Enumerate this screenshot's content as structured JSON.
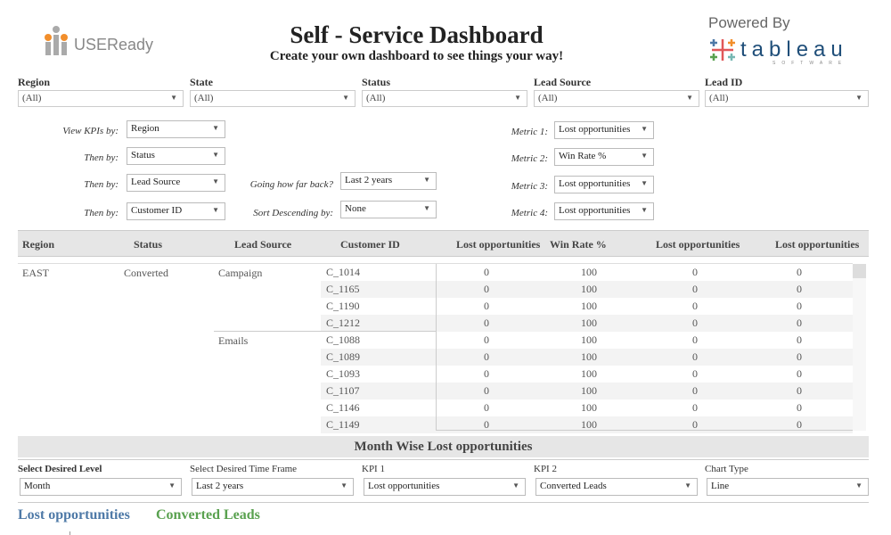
{
  "header": {
    "title": "Self - Service Dashboard",
    "subtitle": "Create your own dashboard to see things your way!",
    "logo_left": "USEReady",
    "powered_by": "Powered By",
    "logo_right": "tableau",
    "logo_right_sub": "SOFTWARE"
  },
  "filters": [
    {
      "label": "Region",
      "value": "(All)"
    },
    {
      "label": "State",
      "value": "(All)"
    },
    {
      "label": "Status",
      "value": "(All)"
    },
    {
      "label": "Lead Source",
      "value": "(All)"
    },
    {
      "label": "Lead ID",
      "value": "(All)"
    }
  ],
  "view_by": [
    {
      "label": "View KPIs by:",
      "value": "Region"
    },
    {
      "label": "Then by:",
      "value": "Status"
    },
    {
      "label": "Then by:",
      "value": "Lead Source"
    },
    {
      "label": "Then by:",
      "value": "Customer ID"
    }
  ],
  "options": [
    {
      "label": "Going how far back?",
      "value": "Last 2 years"
    },
    {
      "label": "Sort Descending by:",
      "value": "None"
    }
  ],
  "metrics": [
    {
      "label": "Metric 1:",
      "value": "Lost opportunities"
    },
    {
      "label": "Metric 2:",
      "value": "Win Rate %"
    },
    {
      "label": "Metric 3:",
      "value": "Lost opportunities"
    },
    {
      "label": "Metric 4:",
      "value": "Lost opportunities"
    }
  ],
  "table": {
    "columns": [
      "Region",
      "Status",
      "Lead Source",
      "Customer ID",
      "Lost opportunities",
      "Win Rate %",
      "Lost opportunities",
      "Lost opportunities"
    ],
    "region": "EAST",
    "status": "Converted",
    "groups": [
      {
        "lead_source": "Campaign",
        "rows": [
          [
            "C_1014",
            "0",
            "100",
            "0",
            "0"
          ],
          [
            "C_1165",
            "0",
            "100",
            "0",
            "0"
          ],
          [
            "C_1190",
            "0",
            "100",
            "0",
            "0"
          ],
          [
            "C_1212",
            "0",
            "100",
            "0",
            "0"
          ]
        ]
      },
      {
        "lead_source": "Emails",
        "rows": [
          [
            "C_1088",
            "0",
            "100",
            "0",
            "0"
          ],
          [
            "C_1089",
            "0",
            "100",
            "0",
            "0"
          ],
          [
            "C_1093",
            "0",
            "100",
            "0",
            "0"
          ],
          [
            "C_1107",
            "0",
            "100",
            "0",
            "0"
          ],
          [
            "C_1146",
            "0",
            "100",
            "0",
            "0"
          ],
          [
            "C_1149",
            "0",
            "100",
            "0",
            "0"
          ]
        ]
      }
    ]
  },
  "section": {
    "title": "Month Wise Lost opportunities"
  },
  "bottom_filters": [
    {
      "label": "Select Desired Level",
      "value": "Month"
    },
    {
      "label": "Select Desired Time Frame",
      "value": "Last 2 years"
    },
    {
      "label": "KPI 1",
      "value": "Lost opportunities"
    },
    {
      "label": "KPI 2",
      "value": "Converted Leads"
    },
    {
      "label": "Chart Type",
      "value": "Line"
    }
  ],
  "legend": {
    "kpi1": "Lost opportunities",
    "kpi2": "Converted Leads",
    "kpi1_color": "#4e79a7",
    "kpi2_color": "#59a14f"
  }
}
